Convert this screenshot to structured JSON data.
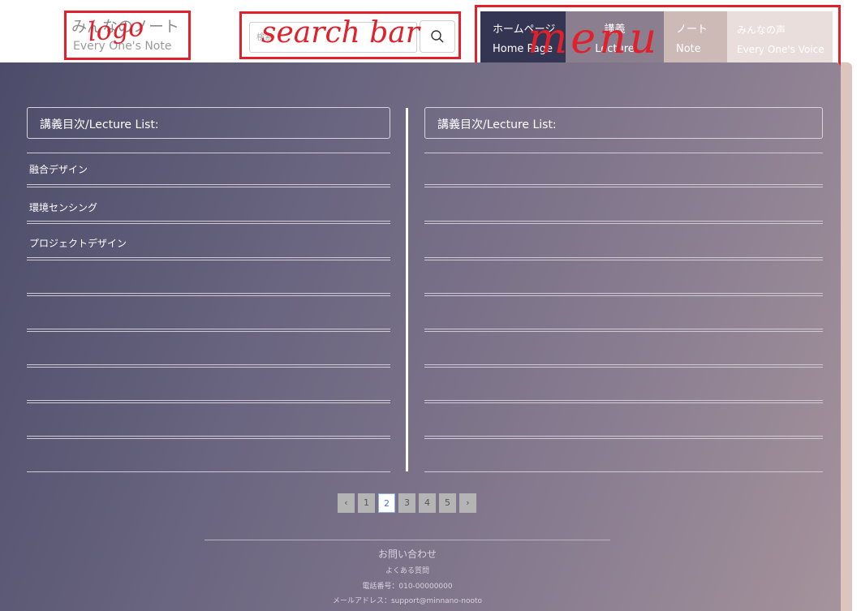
{
  "logo": {
    "title_jp": "みんなのノート",
    "title_en": "Every One's Note",
    "annotation": "logo"
  },
  "search": {
    "placeholder": "検索",
    "annotation": "search bar"
  },
  "menu": {
    "annotation": "menu",
    "items": [
      {
        "jp": "ホームページ",
        "en": "Home Page"
      },
      {
        "jp": "講義",
        "en": "Lecture"
      },
      {
        "jp": "ノート",
        "en": "Note"
      },
      {
        "jp": "みんなの声",
        "en": "Every One's Voice"
      }
    ]
  },
  "lectures": {
    "left_title": "講義目次/Lecture List:",
    "right_title": "講義目次/Lecture List:",
    "left_items": [
      "融合デザイン",
      "環境センシング",
      "プロジェクトデザイン"
    ]
  },
  "pagination": {
    "prev": "‹",
    "next": "›",
    "pages": [
      "1",
      "2",
      "3",
      "4",
      "5"
    ],
    "current": "2"
  },
  "footer": {
    "contact": "お問い合わせ",
    "faq": "よくある質問",
    "phone": "電話番号：010-00000000",
    "email": "メールアドレス：support@minnano-nooto"
  },
  "colors": {
    "accent_red": "#e0202a",
    "menu_home": "#343453",
    "menu_lecture": "#8b7e8e",
    "menu_note": "#cdb9b6",
    "menu_voice": "#eadedc",
    "page_active": "#3a7bd5"
  }
}
